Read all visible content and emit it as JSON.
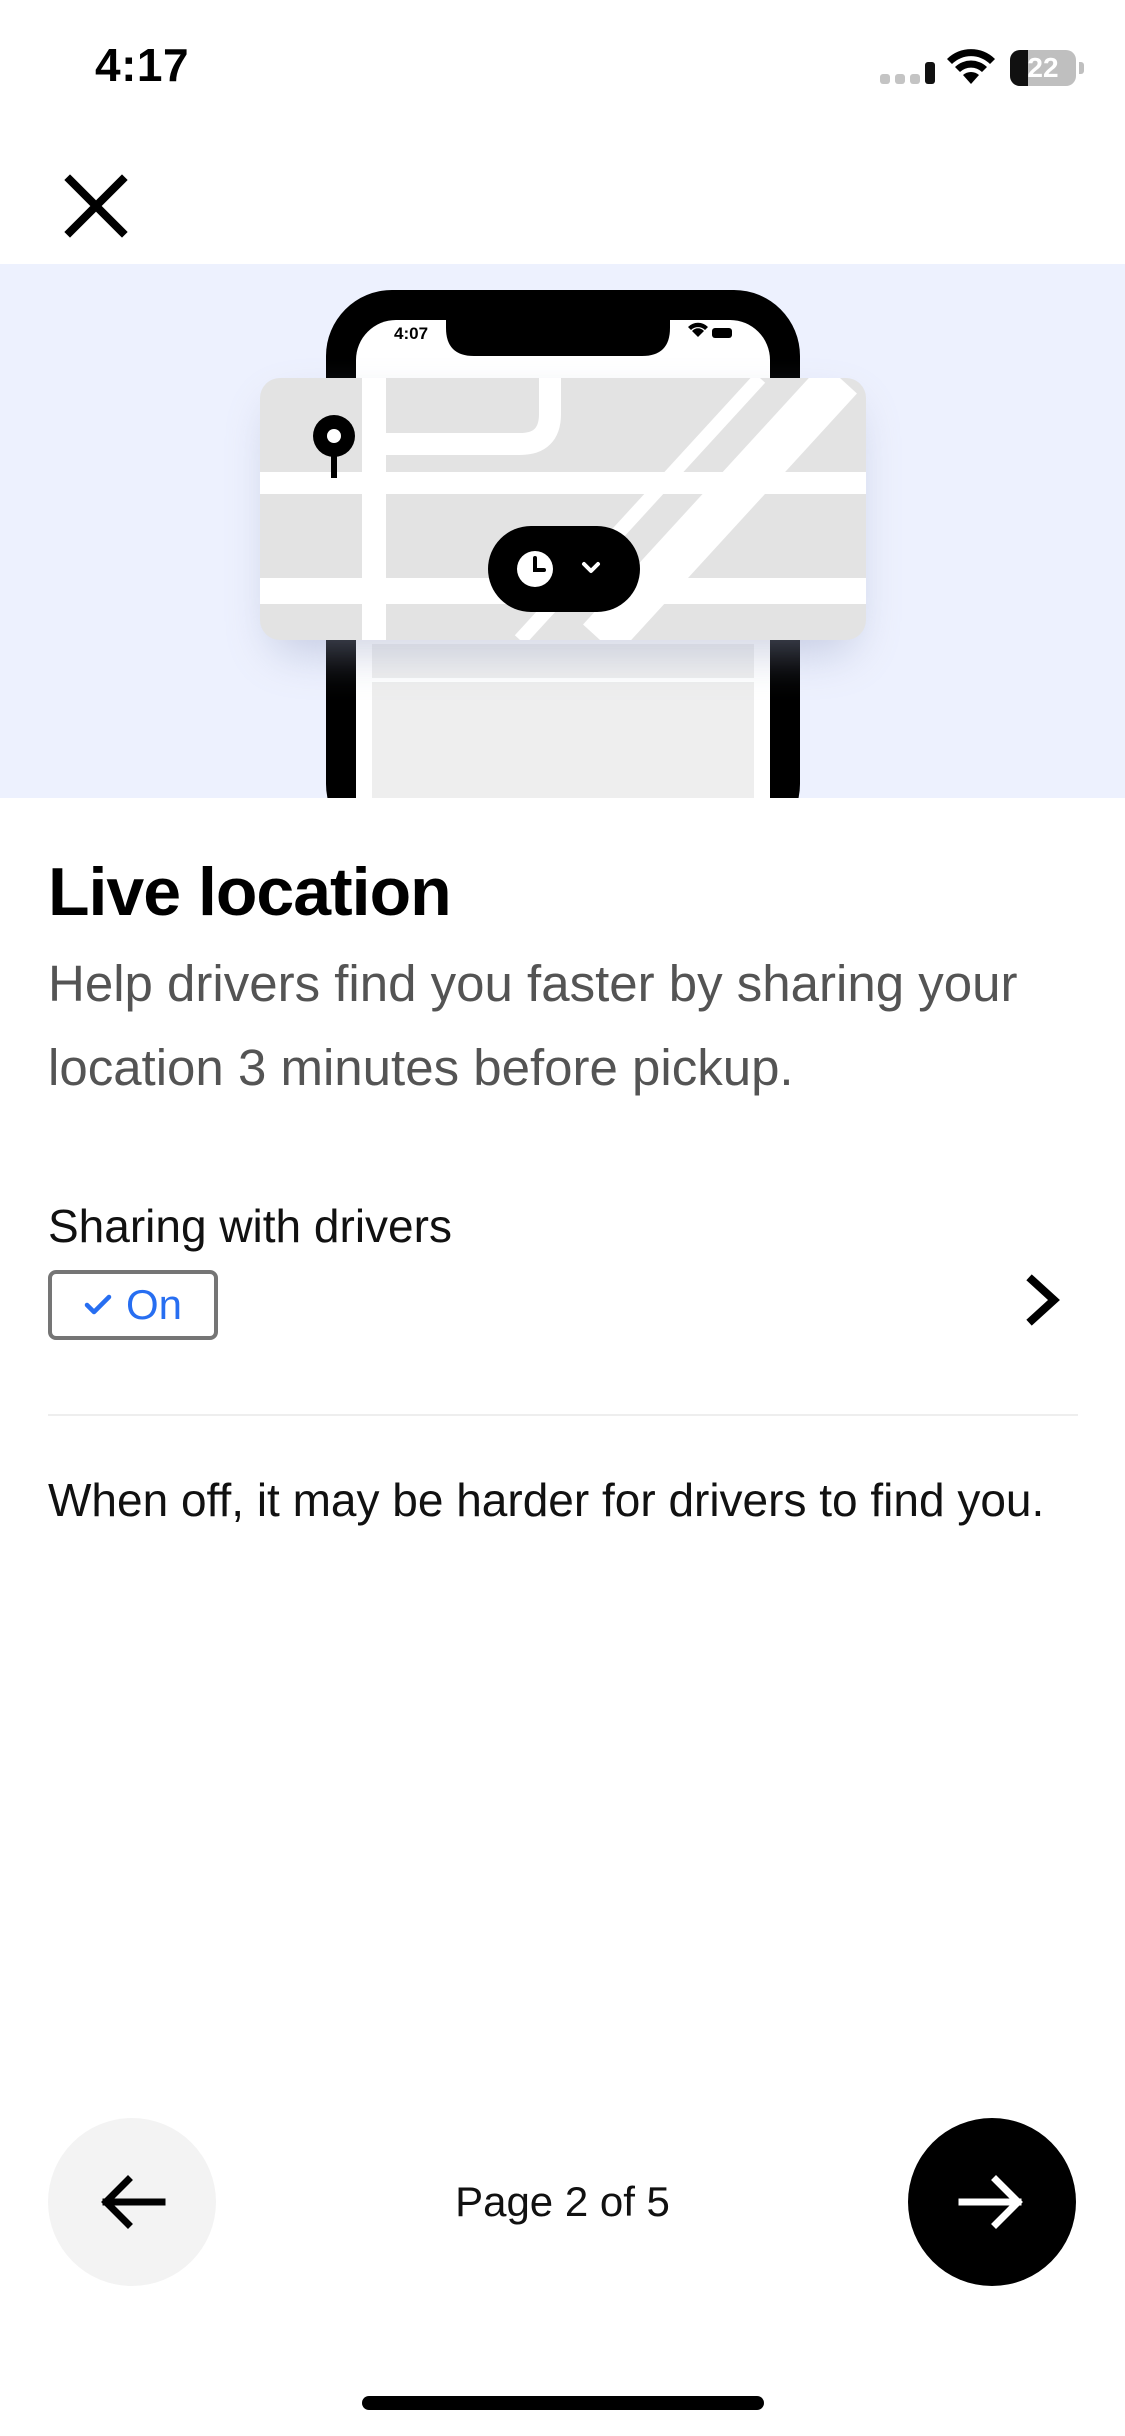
{
  "status_bar": {
    "time": "4:17",
    "battery": "22",
    "icons": [
      "signal-icon",
      "wifi-icon",
      "battery-icon"
    ]
  },
  "header": {
    "close_icon": "close-icon"
  },
  "hero": {
    "phone_time": "4:07",
    "icons": [
      "location-pin-icon",
      "clock-icon",
      "chevron-down-icon"
    ]
  },
  "content": {
    "title": "Live location",
    "subtitle": "Help drivers find you faster by sharing your location 3 minutes before pickup.",
    "setting": {
      "label": "Sharing with drivers",
      "status": "On",
      "status_icon": "checkmark-icon",
      "chevron_icon": "chevron-right-icon"
    },
    "note": "When off, it may be harder for drivers to find you."
  },
  "footer": {
    "back_icon": "arrow-left-icon",
    "page_indicator": "Page 2 of 5",
    "next_icon": "arrow-right-icon"
  },
  "colors": {
    "hero_background": "#edf1fe",
    "accent_blue": "#276ef1",
    "primary": "#000000",
    "secondary_text": "#545454"
  }
}
